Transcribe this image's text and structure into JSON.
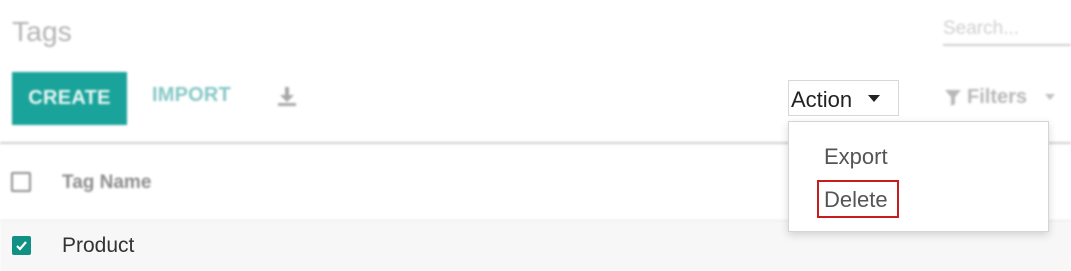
{
  "page": {
    "title": "Tags"
  },
  "search": {
    "placeholder": "Search..."
  },
  "toolbar": {
    "create_label": "CREATE",
    "import_label": "IMPORT",
    "download_icon": "download-icon",
    "action_label": "Action",
    "filters_label": "Filters"
  },
  "action_menu": {
    "items": [
      {
        "label": "Export",
        "highlighted": false
      },
      {
        "label": "Delete",
        "highlighted": true
      }
    ],
    "highlight_color": "#c91c1c"
  },
  "table": {
    "columns": [
      "Tag Name"
    ],
    "rows": [
      {
        "name": "Product",
        "checked": true
      }
    ]
  },
  "colors": {
    "primary": "#1aa39a",
    "checkbox_checked": "#119183"
  }
}
